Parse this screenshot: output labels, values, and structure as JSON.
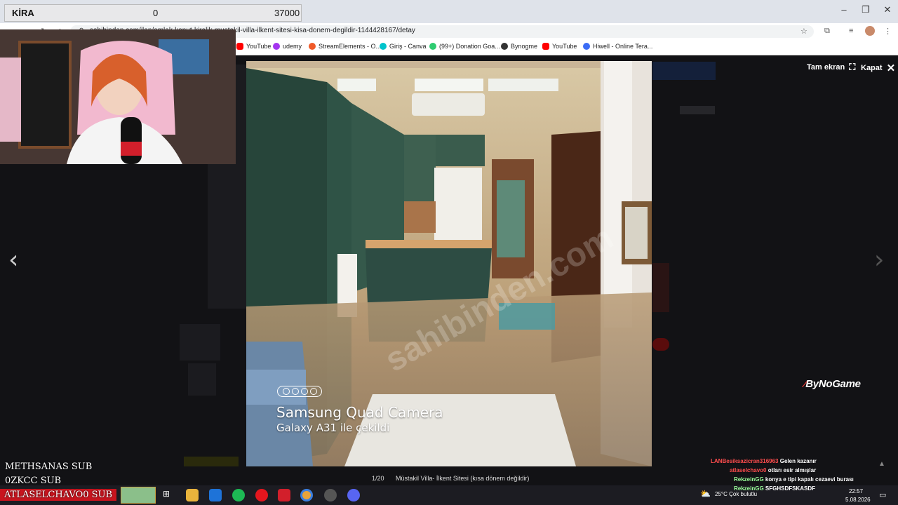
{
  "overlay": {
    "kira_label": "KİRA",
    "kira_min": "0",
    "kira_max": "37000"
  },
  "browser": {
    "url": "sahibinden.com/ilan/emlak-konut-kiralik-mustakil-villa-ilkent-sitesi-kisa-donem-degildir-1144428167/detay",
    "window_controls": [
      "–",
      "❐",
      "✕"
    ],
    "bookmarks": [
      {
        "label": "YouTube",
        "color": "#ff0000"
      },
      {
        "label": "udemy",
        "color": "#a435f0"
      },
      {
        "label": "StreamElements - O...",
        "color": "#f05a28"
      },
      {
        "label": "Giriş - Canva",
        "color": "#00c4cc"
      },
      {
        "label": "(99+) Donation Goa...",
        "color": "#2ecc71"
      },
      {
        "label": "Bynogme",
        "color": "#333333"
      },
      {
        "label": "YouTube",
        "color": "#ff0000"
      },
      {
        "label": "Hiwell - Online Tera...",
        "color": "#3b6cf6"
      }
    ]
  },
  "lightbox": {
    "fullscreen_label": "Tam ekran",
    "close_label": "Kapat",
    "listing_id": "#1144428167",
    "camera_brand": "Samsung Quad Camera",
    "camera_sub": "Galaxy A31 ile çekildi",
    "counter": "1/20",
    "title": "Müstakil Villa- İlkent Sitesi (kısa dönem değildir)",
    "watermark": "sahibinden.com"
  },
  "sponsor": {
    "name": "ByNoGame"
  },
  "subs": [
    "METHSANAS  SUB",
    "0ZKCC  SUB",
    "ATLASELCHAVO0  SUB"
  ],
  "chat": [
    {
      "user": "LANBesiksazicran316963",
      "msg": "Gelen kazanır"
    },
    {
      "user": "atlaselchavo0",
      "msg": "otları esir almışlar"
    },
    {
      "user": "RekzeinGG",
      "msg": "konya e tipi kapalı cezaevi burası"
    },
    {
      "user": "RekzeinGG",
      "msg": "SFGHSDFSKASDF"
    }
  ],
  "tray": {
    "weather": "25°C  Çok bulutlu",
    "time": "22:57",
    "date": "5.08.2026"
  }
}
